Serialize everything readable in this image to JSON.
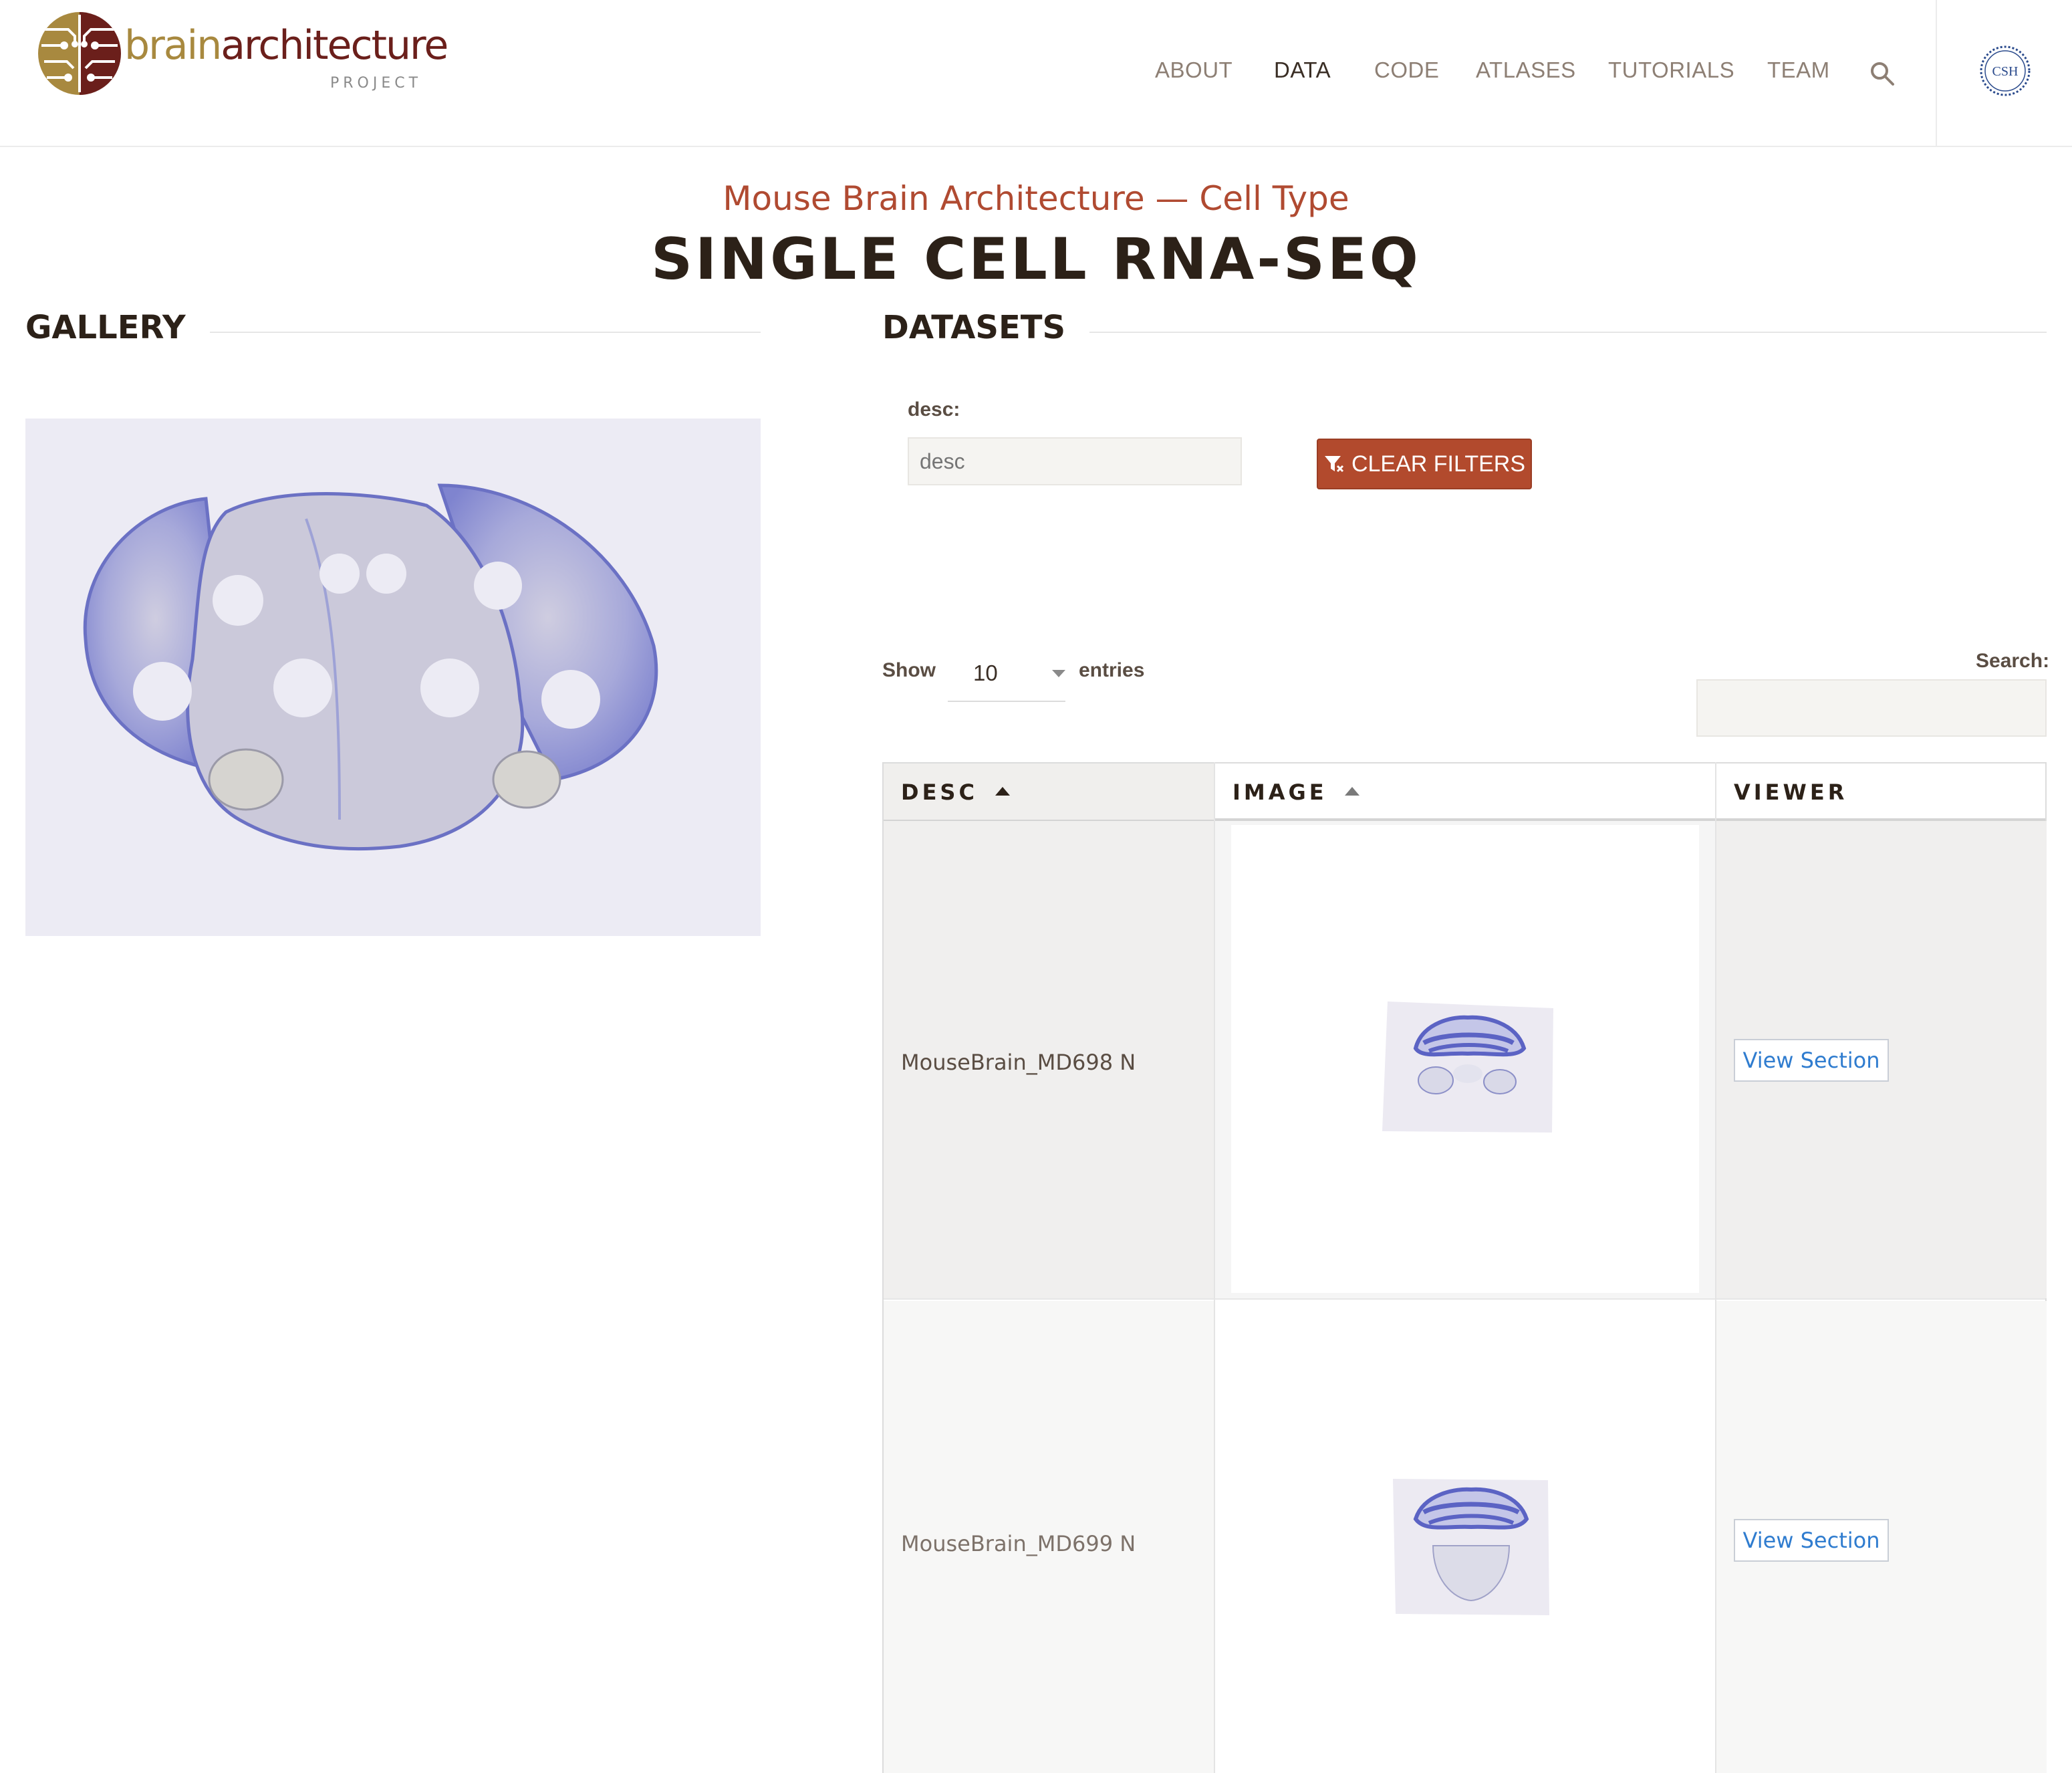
{
  "header": {
    "logo": {
      "word_brain": "brain",
      "word_architecture": "architecture",
      "word_project": "PROJECT"
    },
    "nav": [
      {
        "label": "ABOUT",
        "active": false
      },
      {
        "label": "DATA",
        "active": true
      },
      {
        "label": "CODE",
        "active": false
      },
      {
        "label": "ATLASES",
        "active": false
      },
      {
        "label": "TUTORIALS",
        "active": false
      },
      {
        "label": "TEAM",
        "active": false
      }
    ],
    "search_icon": "search-icon",
    "institution_logo_text": "CSH"
  },
  "page": {
    "subtitle": "Mouse Brain Architecture — Cell Type",
    "title": "SINGLE CELL RNA-SEQ"
  },
  "gallery": {
    "heading": "GALLERY"
  },
  "datasets": {
    "heading": "DATASETS",
    "filter": {
      "label": "desc:",
      "placeholder": "desc",
      "value": ""
    },
    "clear_button": {
      "label": "CLEAR FILTERS",
      "icon": "filter-icon"
    },
    "length_menu": {
      "show_label": "Show",
      "value": "10",
      "entries_label": "entries"
    },
    "search": {
      "label": "Search:",
      "value": ""
    },
    "table": {
      "columns": [
        {
          "label": "DESC",
          "sorted": true
        },
        {
          "label": "IMAGE",
          "sorted": true
        },
        {
          "label": "VIEWER",
          "sorted": false
        }
      ],
      "rows": [
        {
          "desc": "MouseBrain_MD698 N",
          "viewer_label": "View Section"
        },
        {
          "desc": "MouseBrain_MD699 N",
          "viewer_label": "View Section"
        }
      ]
    }
  },
  "colors": {
    "accent": "#b24a2d",
    "subtitle": "#b04a31",
    "link": "#2f7ccf",
    "logo_gold": "#a8893f",
    "logo_maroon": "#6b1f1b",
    "stain_blue": "#6b71c4"
  }
}
